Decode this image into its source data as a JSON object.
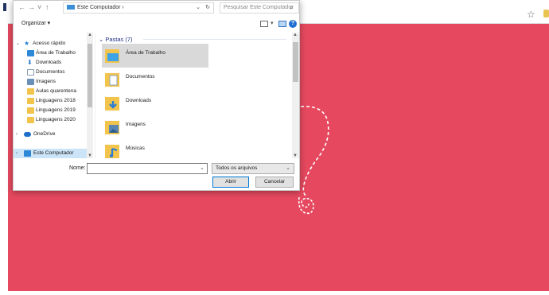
{
  "dialog": {
    "address": {
      "path": "Este Computador  ›",
      "caret": "⌄",
      "refresh": "↻"
    },
    "search": {
      "placeholder": "Pesquisar Este Computador"
    },
    "toolbar": {
      "organize": "Organizar ▾"
    },
    "nav": {
      "items": [
        {
          "label": "Acesso rápido",
          "icon": "star-icon",
          "color": "#2a7fd4"
        },
        {
          "label": "Área de Trabalho",
          "icon": "desktop-icon",
          "color": "#2e88d8"
        },
        {
          "label": "Downloads",
          "icon": "download-icon",
          "color": "#2e78c8"
        },
        {
          "label": "Documentos",
          "icon": "document-icon",
          "color": "#8a9bb0"
        },
        {
          "label": "Imagens",
          "icon": "image-icon",
          "color": "#3b78b8"
        },
        {
          "label": "Aulas quarentena",
          "icon": "folder-icon",
          "color": "#f2c44c"
        },
        {
          "label": "Linguagens 2018",
          "icon": "folder-icon",
          "color": "#f2c44c"
        },
        {
          "label": "Linguagens 2019",
          "icon": "folder-icon",
          "color": "#f2c44c"
        },
        {
          "label": "Linguagens 2020",
          "icon": "folder-icon",
          "color": "#f2c44c"
        },
        {
          "label": "OneDrive",
          "icon": "cloud-icon",
          "color": "#1f6fc8"
        },
        {
          "label": "Este Computador",
          "icon": "computer-icon",
          "color": "#2e88d8"
        }
      ]
    },
    "group": {
      "header": "Pastas (7)"
    },
    "files": [
      {
        "label": "Área de Trabalho",
        "icon": "desktop-folder-icon",
        "accent": "#3da3e8"
      },
      {
        "label": "Documentos",
        "icon": "documents-folder-icon",
        "accent": "#8ea4bd"
      },
      {
        "label": "Downloads",
        "icon": "downloads-folder-icon",
        "accent": "#2b7dd4"
      },
      {
        "label": "Imagens",
        "icon": "pictures-folder-icon",
        "accent": "#5b86b4"
      },
      {
        "label": "Músicas",
        "icon": "music-folder-icon",
        "accent": "#2b7dd4"
      }
    ],
    "footer": {
      "name_label": "Nome:",
      "filter": "Todos os arquivos",
      "open": "Abrir",
      "cancel": "Cancelar"
    }
  },
  "colors": {
    "content_bg": "#e6495f",
    "accent": "#0078d7"
  }
}
